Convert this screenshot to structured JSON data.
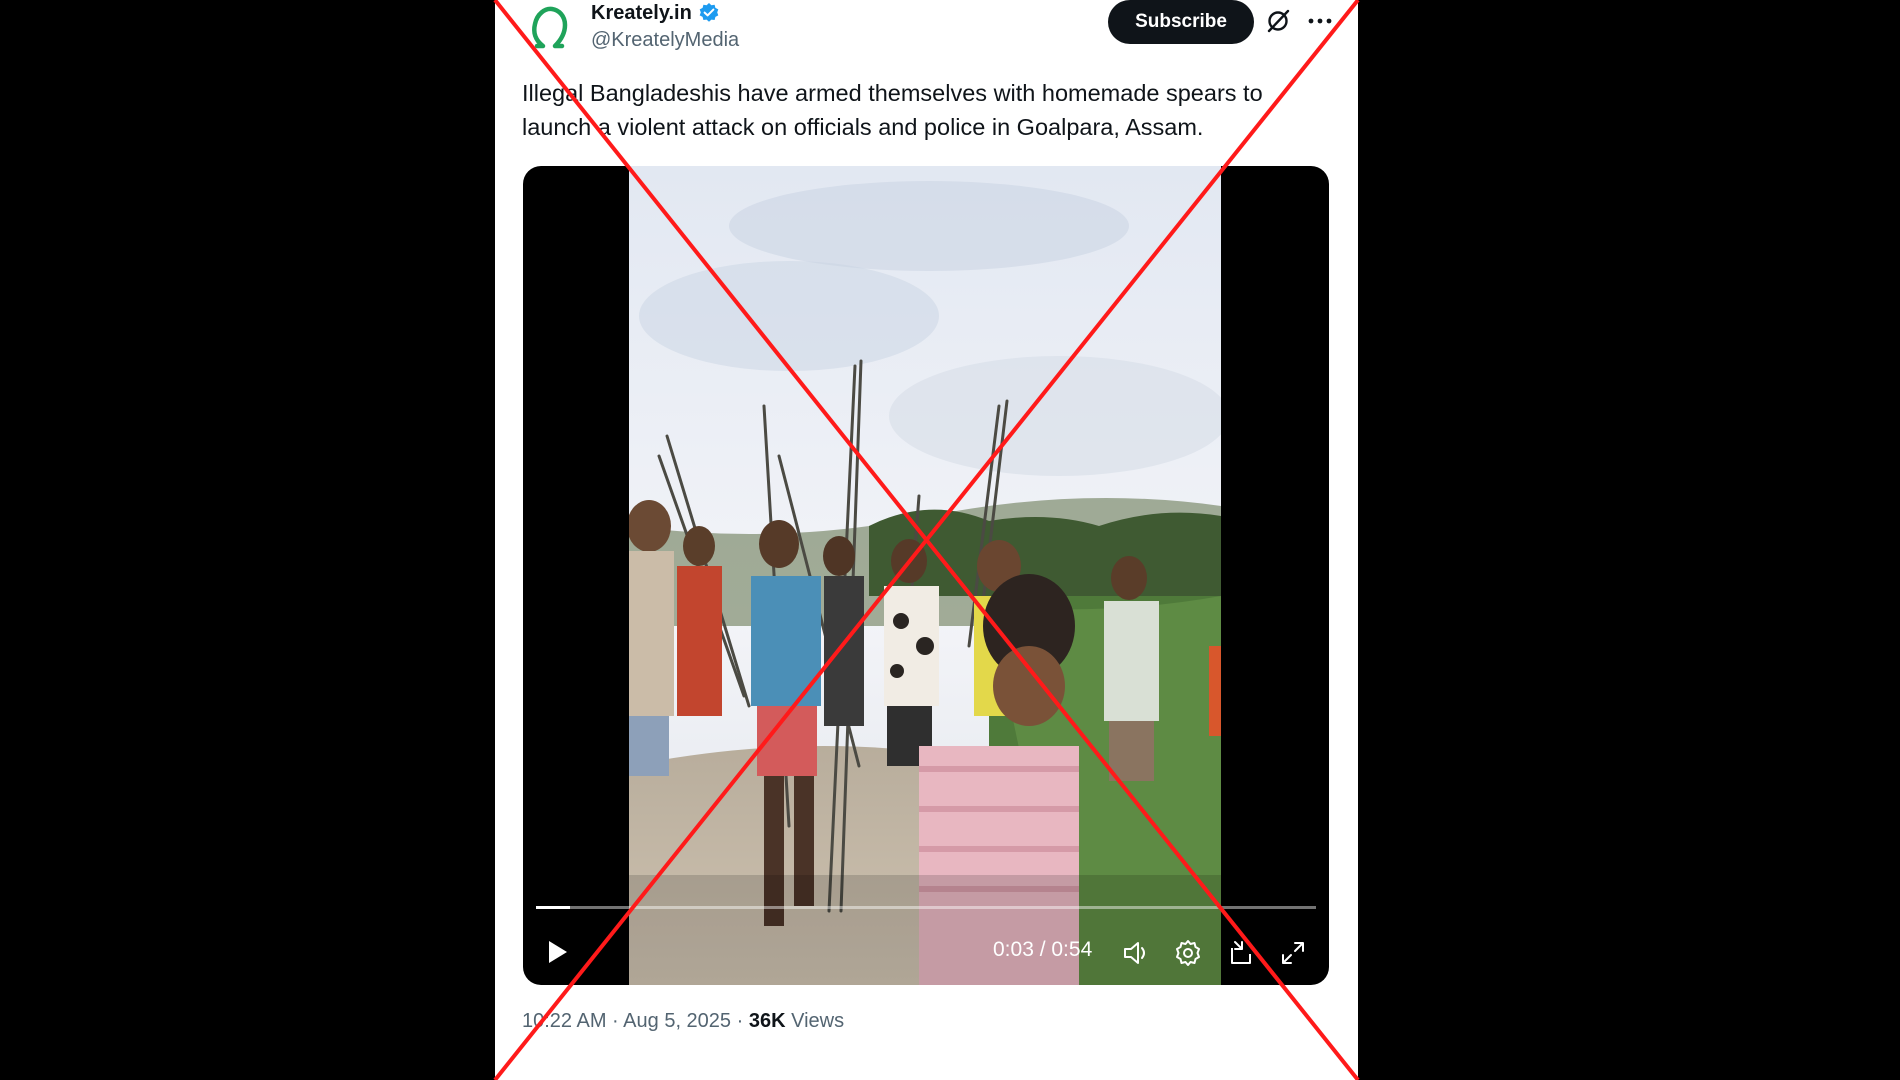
{
  "tweet": {
    "author_name": "Kreately.in",
    "author_handle": "@KreatelyMedia",
    "subscribe_label": "Subscribe",
    "text": "Illegal Bangladeshis have armed themselves with homemade spears to launch a violent attack on officials and police in Goalpara, Assam.",
    "timestamp": "10:22 AM · Aug 5, 2025 · ",
    "views_count": "36K",
    "views_label": " Views"
  },
  "video": {
    "time_display": "0:03 / 0:54",
    "progress_fraction": 0.043
  },
  "icons": {
    "avatar": "kreately-omega-logo",
    "verified": "verified-badge-icon",
    "grok": "grok-icon",
    "more": "more-icon",
    "play": "play-icon",
    "volume": "volume-icon",
    "settings": "settings-icon",
    "popout": "popout-icon",
    "fullscreen": "fullscreen-icon"
  },
  "colors": {
    "accent_blue": "#1d9bf0",
    "brand_green": "#1fa35a",
    "text_primary": "#0f1419",
    "text_secondary": "#536471",
    "overlay_red": "#ff1a1a"
  }
}
